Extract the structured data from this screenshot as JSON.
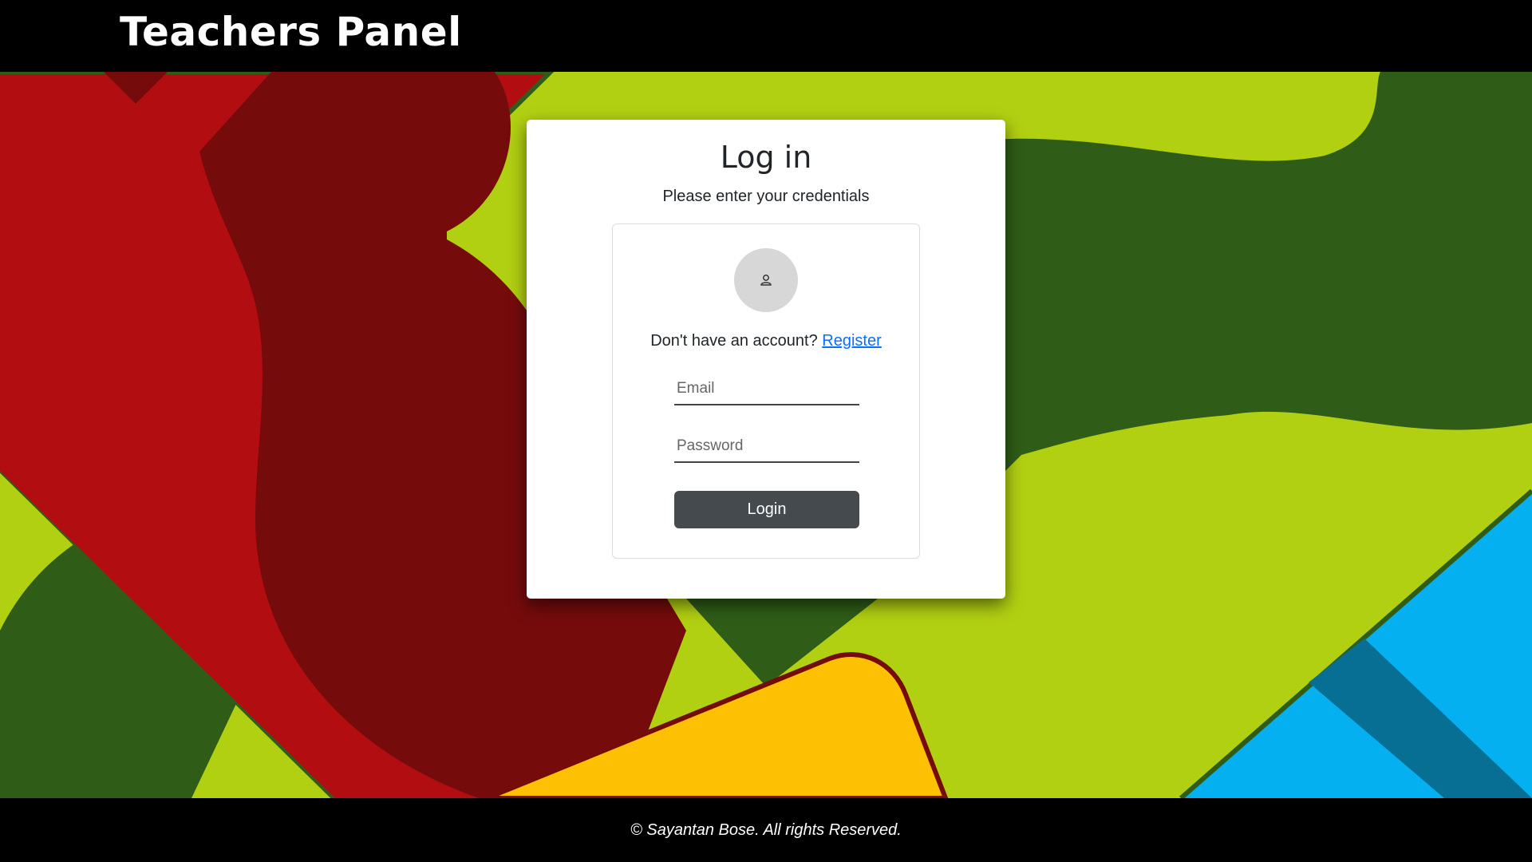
{
  "header": {
    "title": "Teachers Panel"
  },
  "login_card": {
    "title": "Log in",
    "subtitle": "Please enter your credentials",
    "avatar_icon": "user-icon",
    "register_prompt": "Don't have an account?",
    "register_link": "Register",
    "email_placeholder": "Email",
    "email_value": "",
    "password_placeholder": "Password",
    "password_value": "",
    "login_button": "Login"
  },
  "footer": {
    "copyright": "© Sayantan Bose. All rights Reserved."
  },
  "colors": {
    "header_bg": "#000000",
    "button_bg": "#454a4f",
    "link": "#0d6efd",
    "bg_lime": "#b2d012",
    "bg_dark_green": "#2f5d18",
    "bg_red": "#b20d10",
    "bg_dark_red": "#760b0c",
    "bg_yellow": "#fdc003",
    "bg_blue": "#05b0f1"
  }
}
